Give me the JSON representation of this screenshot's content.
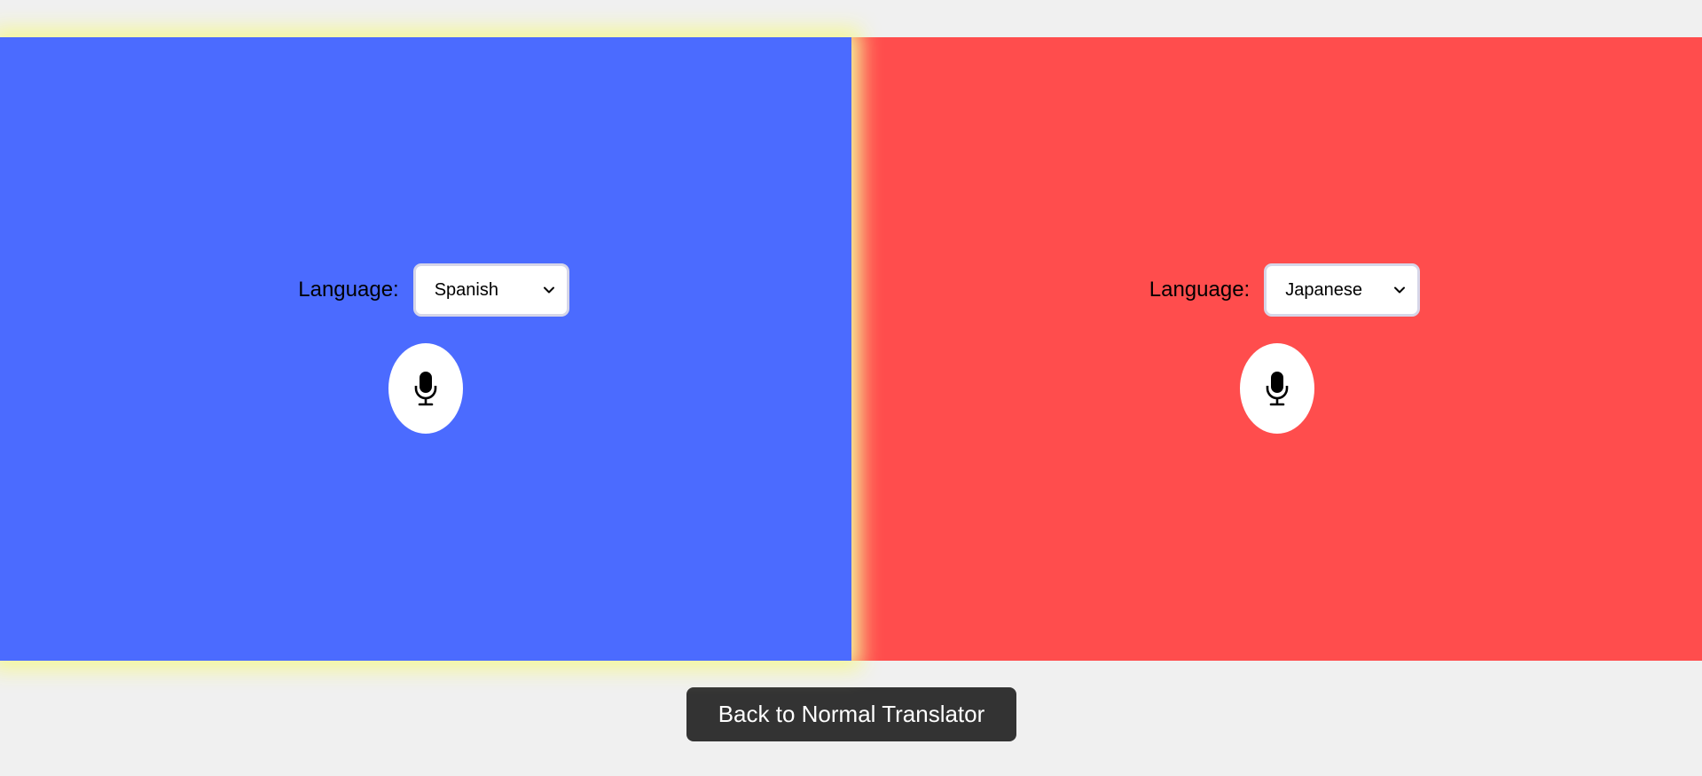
{
  "left_panel": {
    "color": "#4b6bff",
    "language_label": "Language:",
    "selected_language": "Spanish",
    "mic_icon": "microphone-icon"
  },
  "right_panel": {
    "color": "#ff4d4d",
    "language_label": "Language:",
    "selected_language": "Japanese",
    "mic_icon": "microphone-icon"
  },
  "active_highlight_color": "#f4f79a",
  "footer": {
    "back_button_label": "Back to Normal Translator"
  }
}
